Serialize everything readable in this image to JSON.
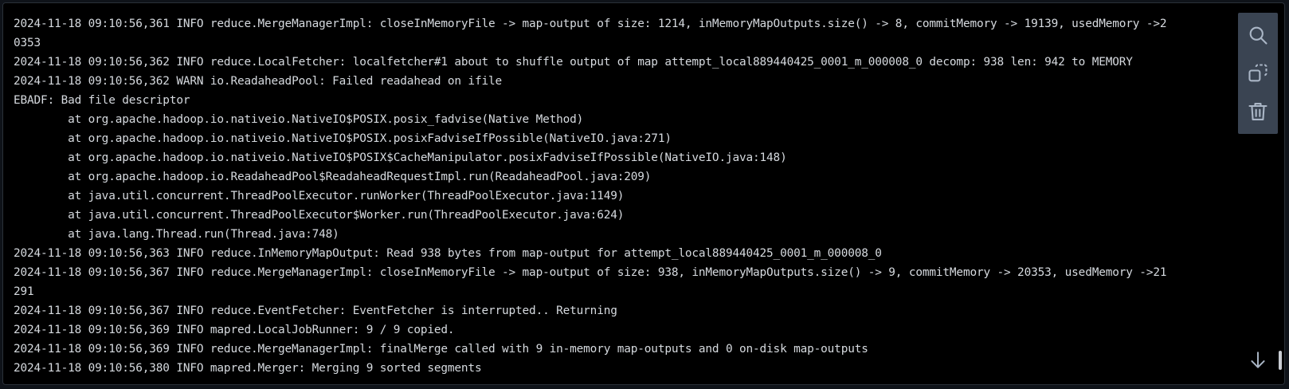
{
  "log": {
    "lines": [
      "2024-11-18 09:10:56,361 INFO reduce.MergeManagerImpl: closeInMemoryFile -> map-output of size: 1214, inMemoryMapOutputs.size() -> 8, commitMemory -> 19139, usedMemory ->2",
      "0353",
      "2024-11-18 09:10:56,362 INFO reduce.LocalFetcher: localfetcher#1 about to shuffle output of map attempt_local889440425_0001_m_000008_0 decomp: 938 len: 942 to MEMORY",
      "2024-11-18 09:10:56,362 WARN io.ReadaheadPool: Failed readahead on ifile",
      "EBADF: Bad file descriptor",
      "        at org.apache.hadoop.io.nativeio.NativeIO$POSIX.posix_fadvise(Native Method)",
      "        at org.apache.hadoop.io.nativeio.NativeIO$POSIX.posixFadviseIfPossible(NativeIO.java:271)",
      "        at org.apache.hadoop.io.nativeio.NativeIO$POSIX$CacheManipulator.posixFadviseIfPossible(NativeIO.java:148)",
      "        at org.apache.hadoop.io.ReadaheadPool$ReadaheadRequestImpl.run(ReadaheadPool.java:209)",
      "        at java.util.concurrent.ThreadPoolExecutor.runWorker(ThreadPoolExecutor.java:1149)",
      "        at java.util.concurrent.ThreadPoolExecutor$Worker.run(ThreadPoolExecutor.java:624)",
      "        at java.lang.Thread.run(Thread.java:748)",
      "2024-11-18 09:10:56,363 INFO reduce.InMemoryMapOutput: Read 938 bytes from map-output for attempt_local889440425_0001_m_000008_0",
      "2024-11-18 09:10:56,367 INFO reduce.MergeManagerImpl: closeInMemoryFile -> map-output of size: 938, inMemoryMapOutputs.size() -> 9, commitMemory -> 20353, usedMemory ->21",
      "291",
      "2024-11-18 09:10:56,367 INFO reduce.EventFetcher: EventFetcher is interrupted.. Returning",
      "2024-11-18 09:10:56,369 INFO mapred.LocalJobRunner: 9 / 9 copied.",
      "2024-11-18 09:10:56,369 INFO reduce.MergeManagerImpl: finalMerge called with 9 in-memory map-outputs and 0 on-disk map-outputs",
      "2024-11-18 09:10:56,380 INFO mapred.Merger: Merging 9 sorted segments"
    ]
  },
  "toolbar": {
    "icons": [
      "search-icon",
      "copy-icon",
      "trash-icon"
    ]
  },
  "scroll": {
    "icon": "arrow-down-icon",
    "position_fraction": 0.96
  },
  "colors": {
    "background": "#000000",
    "text": "#d6dadf",
    "toolbar": "#3a4452",
    "icon": "#aab6c6"
  }
}
